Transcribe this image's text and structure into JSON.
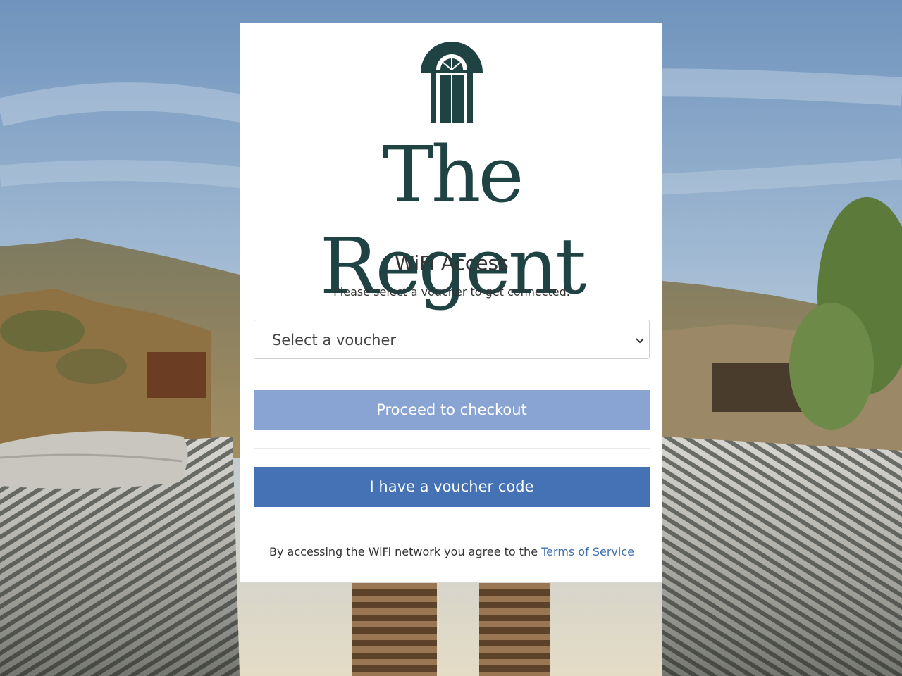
{
  "brand": {
    "name": "The Regent",
    "color": "#1f4343",
    "logo_icon": "arched-door-icon"
  },
  "portal": {
    "title": "WiFi Access",
    "subtitle": "Please select a voucher to get connected."
  },
  "voucher_select": {
    "selected_value": "Select a voucher",
    "icon": "chevron-down-icon"
  },
  "buttons": {
    "checkout_label": "Proceed to checkout",
    "checkout_color": "#89a3d2",
    "voucher_code_label": "I have a voucher code",
    "voucher_code_color": "#4472b4"
  },
  "terms": {
    "prefix": "By accessing the WiFi network you agree to the ",
    "link_label": "Terms of Service",
    "link_color": "#3f6fb0"
  }
}
